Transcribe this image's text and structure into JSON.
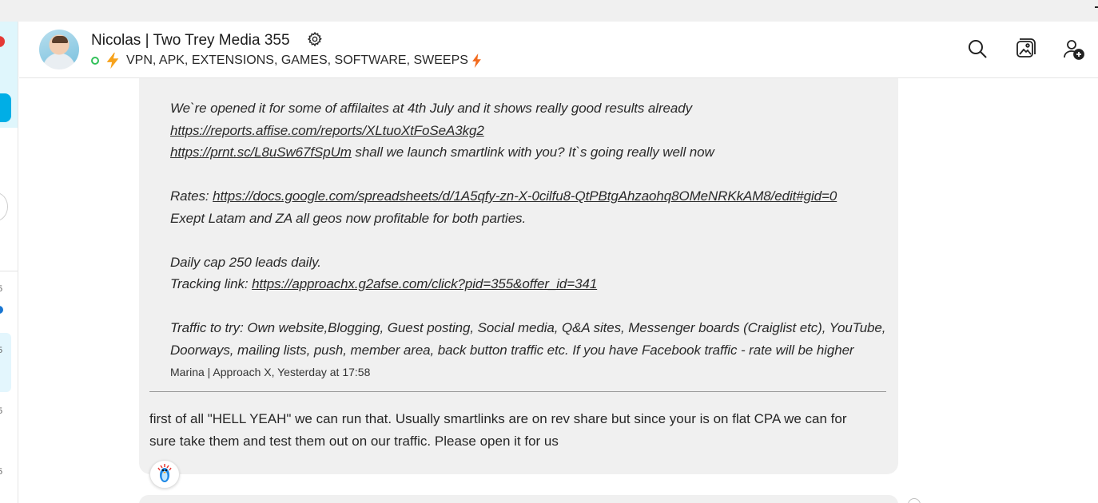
{
  "header": {
    "title": "Nicolas | Two Trey Media 355",
    "subtitle": "VPN, APK, EXTENSIONS, GAMES, SOFTWARE, SWEEPS",
    "icons": [
      "search-icon",
      "media-gallery-icon",
      "add-people-icon",
      "gear-icon",
      "lightning-icon"
    ]
  },
  "sidebar": {
    "numbers": [
      "5",
      "5",
      "5",
      "5"
    ]
  },
  "message": {
    "quote": {
      "line1": "We`re opened it for some of affilaites at 4th July and it shows really good results already",
      "link1": "https://reports.affise.com/reports/XLtuoXtFoSeA3kg2",
      "link2": "https://prnt.sc/L8uSw67fSpUm",
      "line3_rest": " shall we launch smartlink with you? It`s going really well now",
      "rates_label": "Rates: ",
      "rates_link": "https://docs.google.com/spreadsheets/d/1A5qfy-zn-X-0cilfu8-QtPBtgAhzaohq8OMeNRKkAM8/edit#gid=0",
      "line5": "Exept Latam and ZA all geos now profitable for both parties.",
      "line6": "Daily cap 250 leads daily.",
      "tracking_label": "Tracking link: ",
      "tracking_link": "https://approachx.g2afse.com/click?pid=355&offer_id=341",
      "traffic": "Traffic to try: Own website,Blogging, Guest posting, Social media, Q&A sites, Messenger boards (Craiglist etc), YouTube, Doorways, mailing lists, push, member area, back button traffic etc. If you have Facebook traffic - rate will be higher",
      "meta": "Marina | Approach X, Yesterday at 17:58"
    },
    "reply": "first of all \"HELL YEAH\" we can run that. Usually smartlinks are on rev share but since your is on flat CPA we can for sure take them and test them out on our traffic. Please open it for us"
  },
  "colors": {
    "bubble": "#f0f0f0",
    "online": "#33c15a",
    "bolt": "#f7a21b",
    "accent_cyan": "#00aee6"
  }
}
